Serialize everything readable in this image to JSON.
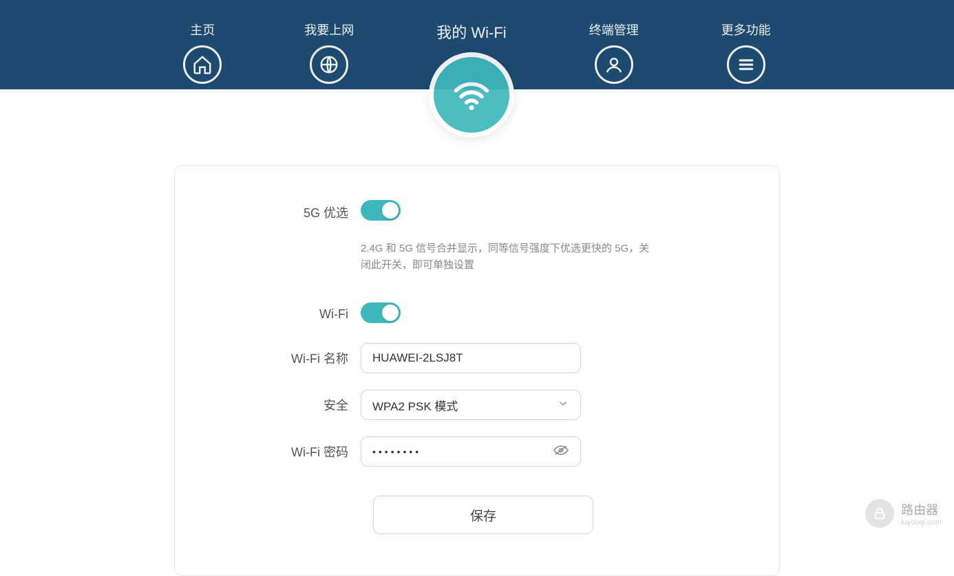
{
  "nav": {
    "home": "主页",
    "internet": "我要上网",
    "wifi": "我的 Wi-Fi",
    "terminals": "终端管理",
    "more": "更多功能"
  },
  "form": {
    "fiveg_label": "5G 优选",
    "fiveg_help": "2.4G 和 5G 信号合并显示，同等信号强度下优选更快的 5G，关闭此开关，即可单独设置",
    "wifi_label": "Wi-Fi",
    "name_label": "Wi-Fi 名称",
    "name_value": "HUAWEI-2LSJ8T",
    "security_label": "安全",
    "security_value": "WPA2 PSK 模式",
    "password_label": "Wi-Fi 密码",
    "password_value": "••••••••",
    "save_label": "保存"
  },
  "watermark": {
    "title": "路由器",
    "sub": "luyouqi.com"
  }
}
